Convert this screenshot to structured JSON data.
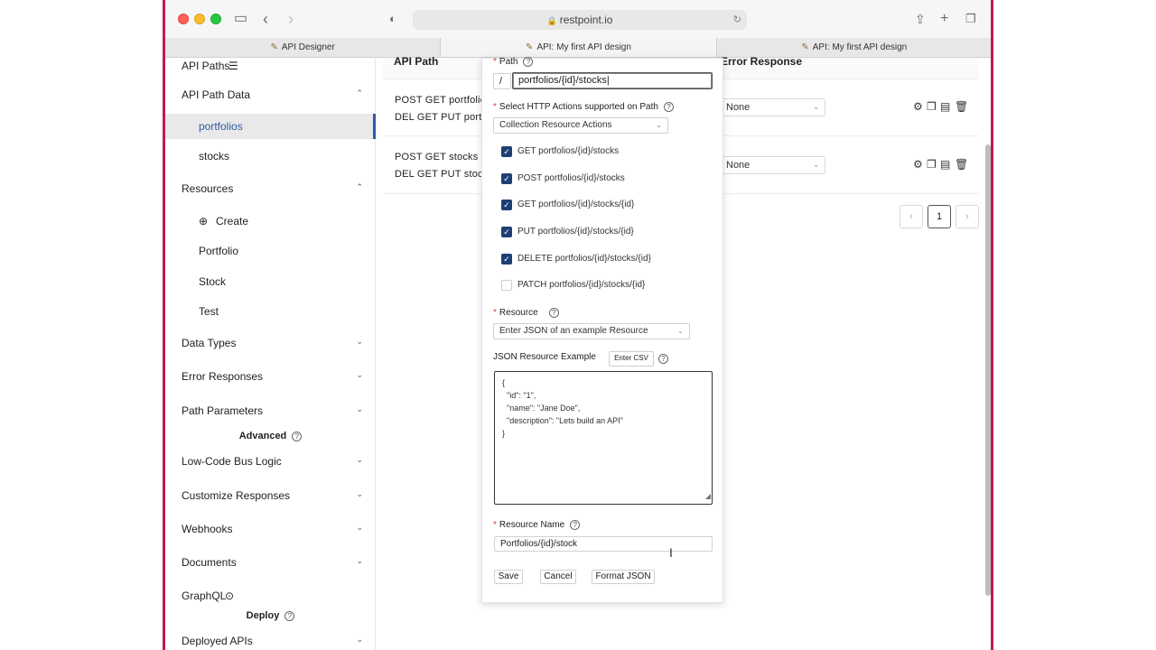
{
  "browser": {
    "url": "restpoint.io",
    "tabs": [
      {
        "label": "API Designer",
        "active": false
      },
      {
        "label": "API: My first API design",
        "active": true
      },
      {
        "label": "API: My first API design",
        "active": false
      }
    ]
  },
  "sidebar": {
    "api_paths": "API Paths",
    "api_path_data": "API Path Data",
    "path_items": [
      "portfolios",
      "stocks"
    ],
    "resources": "Resources",
    "create": "Create",
    "resource_items": [
      "Portfolio",
      "Stock",
      "Test"
    ],
    "data_types": "Data Types",
    "error_responses": "Error Responses",
    "path_parameters": "Path Parameters",
    "advanced": "Advanced",
    "low_code": "Low-Code Bus Logic",
    "customize": "Customize Responses",
    "webhooks": "Webhooks",
    "documents": "Documents",
    "graphql": "GraphQL",
    "deploy": "Deploy",
    "deployed_apis": "Deployed APIs"
  },
  "table": {
    "col_api_path": "API Path",
    "col_error_response": "Error Response",
    "rows": [
      {
        "line1": "POST GET  portfolios",
        "line2": "DEL GET PUT  portfolios",
        "error": "None"
      },
      {
        "line1": "POST GET  stocks",
        "line2": "DEL GET PUT  stocks",
        "error": "None"
      }
    ],
    "page": "1"
  },
  "modal": {
    "path_label": "Path",
    "path_prefix": "/",
    "path_value": "portfolios/{id}/stocks",
    "actions_label": "Select HTTP Actions supported on Path",
    "actions_select": "Collection Resource Actions",
    "actions": [
      {
        "label": "GET portfolios/{id}/stocks",
        "checked": true
      },
      {
        "label": "POST portfolios/{id}/stocks",
        "checked": true
      },
      {
        "label": "GET portfolios/{id}/stocks/{id}",
        "checked": true
      },
      {
        "label": "PUT portfolios/{id}/stocks/{id}",
        "checked": true
      },
      {
        "label": "DELETE portfolios/{id}/stocks/{id}",
        "checked": true
      },
      {
        "label": "PATCH portfolios/{id}/stocks/{id}",
        "checked": false
      }
    ],
    "resource_label": "Resource",
    "resource_select": "Enter JSON of an example Resource",
    "json_label": "JSON Resource Example",
    "enter_csv": "Enter CSV",
    "json_text": "{\n  \"id\": \"1\",\n  \"name\": \"Jane Doe\",\n  \"description\": \"Lets build an API\"\n}",
    "resource_name_label": "Resource Name",
    "resource_name_value": "Portfolios/{id}/stock",
    "save": "Save",
    "cancel": "Cancel",
    "format_json": "Format JSON"
  }
}
